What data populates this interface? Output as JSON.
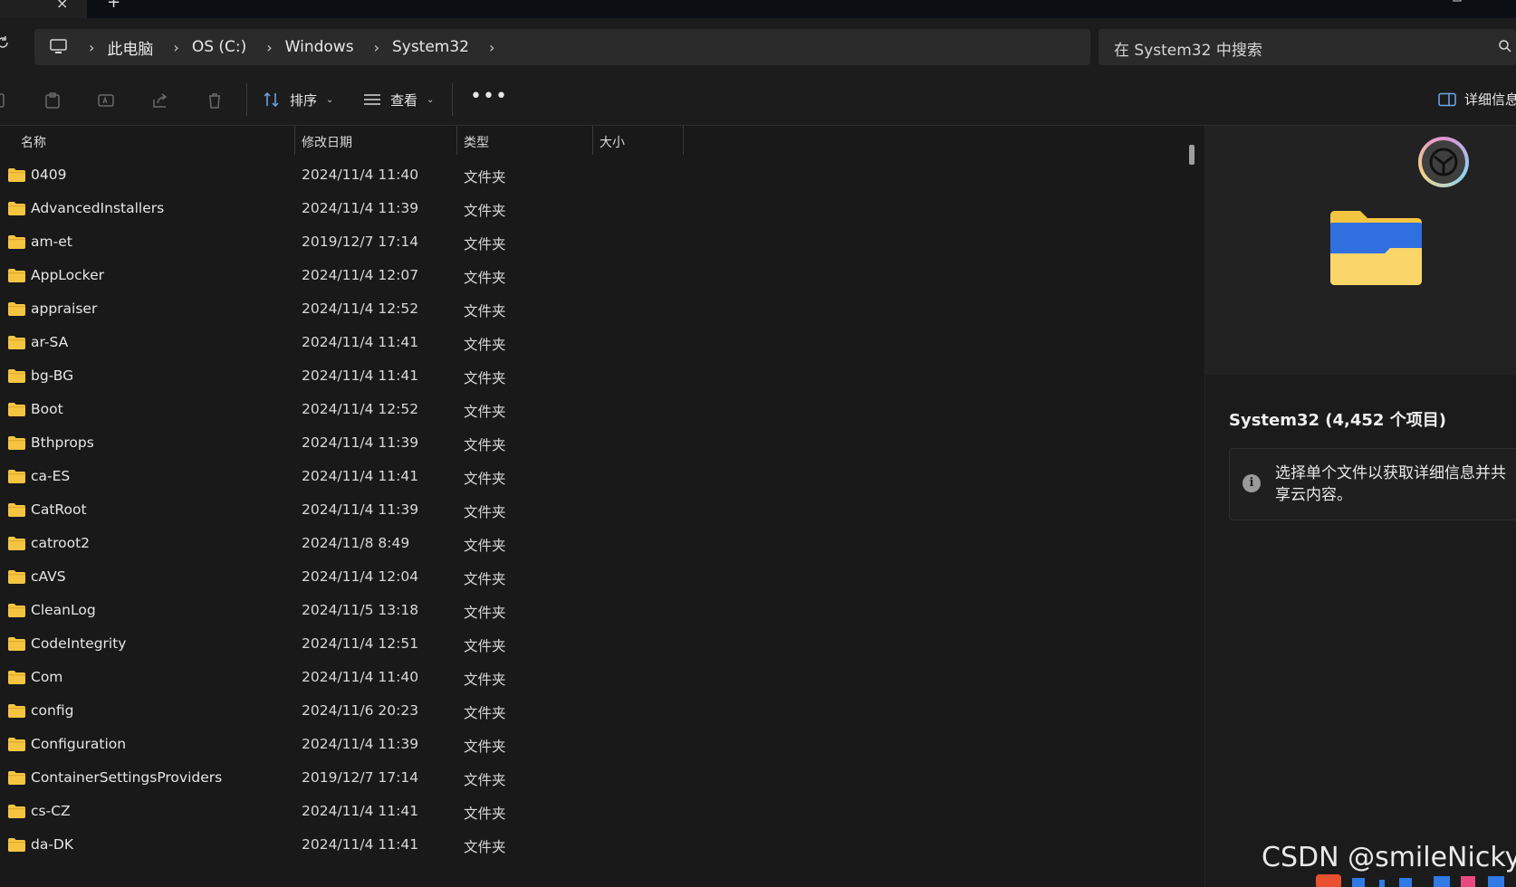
{
  "tabbar": {
    "close_glyph": "×",
    "add_glyph": "+"
  },
  "nav": {
    "refresh_icon": "refresh-icon"
  },
  "breadcrumb": {
    "items": [
      "此电脑",
      "OS (C:)",
      "Windows",
      "System32"
    ]
  },
  "search": {
    "placeholder": "在 System32 中搜索"
  },
  "toolbar": {
    "sort_label": "排序",
    "view_label": "查看",
    "details_label": "详细信息"
  },
  "columns": {
    "name": "名称",
    "modified": "修改日期",
    "type": "类型",
    "size": "大小"
  },
  "files": [
    {
      "name": "0409",
      "modified": "2024/11/4 11:40",
      "type": "文件夹"
    },
    {
      "name": "AdvancedInstallers",
      "modified": "2024/11/4 11:39",
      "type": "文件夹"
    },
    {
      "name": "am-et",
      "modified": "2019/12/7 17:14",
      "type": "文件夹"
    },
    {
      "name": "AppLocker",
      "modified": "2024/11/4 12:07",
      "type": "文件夹"
    },
    {
      "name": "appraiser",
      "modified": "2024/11/4 12:52",
      "type": "文件夹"
    },
    {
      "name": "ar-SA",
      "modified": "2024/11/4 11:41",
      "type": "文件夹"
    },
    {
      "name": "bg-BG",
      "modified": "2024/11/4 11:41",
      "type": "文件夹"
    },
    {
      "name": "Boot",
      "modified": "2024/11/4 12:52",
      "type": "文件夹"
    },
    {
      "name": "Bthprops",
      "modified": "2024/11/4 11:39",
      "type": "文件夹"
    },
    {
      "name": "ca-ES",
      "modified": "2024/11/4 11:41",
      "type": "文件夹"
    },
    {
      "name": "CatRoot",
      "modified": "2024/11/4 11:39",
      "type": "文件夹"
    },
    {
      "name": "catroot2",
      "modified": "2024/11/8 8:49",
      "type": "文件夹"
    },
    {
      "name": "cAVS",
      "modified": "2024/11/4 12:04",
      "type": "文件夹"
    },
    {
      "name": "CleanLog",
      "modified": "2024/11/5 13:18",
      "type": "文件夹"
    },
    {
      "name": "CodeIntegrity",
      "modified": "2024/11/4 12:51",
      "type": "文件夹"
    },
    {
      "name": "Com",
      "modified": "2024/11/4 11:40",
      "type": "文件夹"
    },
    {
      "name": "config",
      "modified": "2024/11/6 20:23",
      "type": "文件夹"
    },
    {
      "name": "Configuration",
      "modified": "2024/11/4 11:39",
      "type": "文件夹"
    },
    {
      "name": "ContainerSettingsProviders",
      "modified": "2019/12/7 17:14",
      "type": "文件夹"
    },
    {
      "name": "cs-CZ",
      "modified": "2024/11/4 11:41",
      "type": "文件夹"
    },
    {
      "name": "da-DK",
      "modified": "2024/11/4 11:41",
      "type": "文件夹"
    }
  ],
  "details": {
    "title": "System32 (4,452 个项目)",
    "info": "选择单个文件以获取详细信息并共享云内容。"
  },
  "watermark": "CSDN @smileNicky",
  "colors": {
    "folder_yellow": "#f5c542",
    "folder_blue": "#2f6fe0",
    "background": "#191919"
  }
}
